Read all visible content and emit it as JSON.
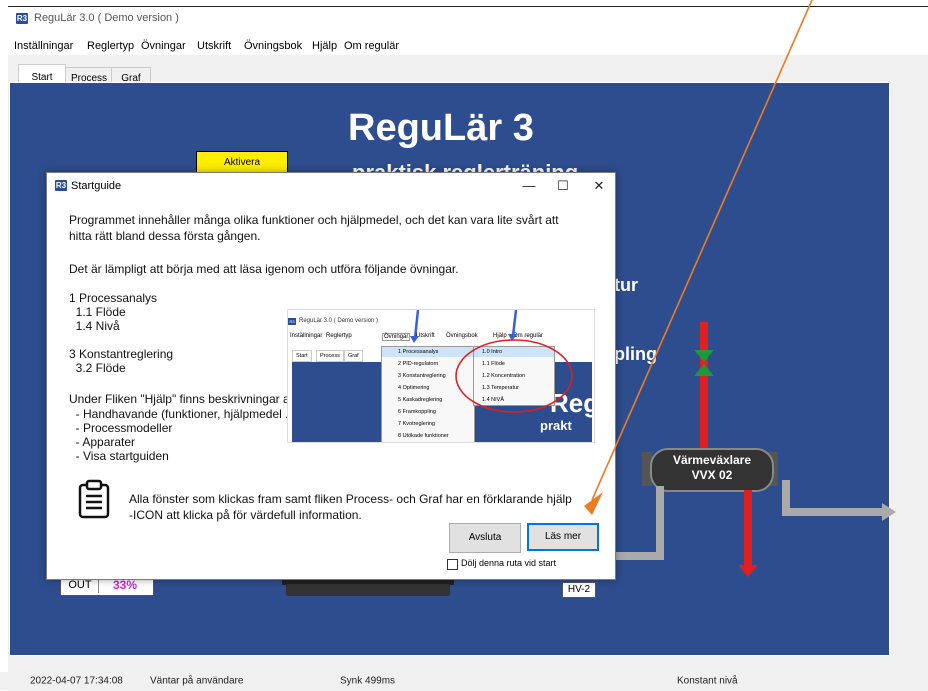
{
  "window": {
    "title": "ReguLär 3.0  ( Demo version )",
    "app_icon": "R3"
  },
  "menu": [
    "Inställningar",
    "Reglertyp",
    "Övningar",
    "Utskrift",
    "Övningsbok",
    "Hjälp",
    "Om regulär"
  ],
  "tabs": [
    "Start",
    "Process",
    "Graf"
  ],
  "background": {
    "title": "ReguLär 3",
    "subtitle": "praktisk reglerträning",
    "aktivera_label": "Aktivera",
    "label_tur": "tur",
    "label_pling": "pling",
    "heat_exchanger": [
      "Värmeväxlare",
      "VVX 02"
    ],
    "valve_label": "HV-2",
    "out_label": "OUT",
    "out_value": "33%",
    "colors": {
      "panel": "#2e4d8e",
      "hot_pipe": "#e02020",
      "valve": "#1a9a3a",
      "out_value": "#e020e0"
    }
  },
  "status_bar": {
    "timestamp": "2022-04-07 17:34:08",
    "state": "Väntar på användare",
    "sync": "Synk 499ms",
    "mode": "Konstant nivå"
  },
  "dialog": {
    "title": "Startguide",
    "window_buttons": {
      "minimize": "—",
      "maximize": "☐",
      "close": "✕"
    },
    "intro_lines": [
      "Programmet innehåller många olika funktioner och hjälpmedel, och det kan vara lite svårt att",
      "hitta rätt bland dessa första gången."
    ],
    "recommend": "Det är lämpligt att börja med att läsa igenom och utföra följande övningar.",
    "exercises": [
      "1 Processanalys",
      "  1.1 Flöde",
      "  1.4 Nivå",
      "",
      "3 Konstantreglering",
      "  3.2 Flöde"
    ],
    "help_intro": "Under Fliken \"Hjälp\" finns beskrivningar av",
    "help_items": [
      "  - Handhavande (funktioner, hjälpmedel ..)",
      "  - Processmodeller",
      "  - Apparater",
      "  - Visa startguiden"
    ],
    "footer_lines": [
      "Alla fönster som klickas fram samt fliken Process- och Graf har en förklarande hjälp",
      "-ICON att klicka på för värdefull information."
    ],
    "btn_quit": "Avsluta",
    "btn_read_more": "Läs mer",
    "checkbox_label": "Dölj denna ruta vid start",
    "checkbox_checked": false
  },
  "mini_screenshot": {
    "title": "ReguLär 3.0  ( Demo version )",
    "menu": [
      "Inställningar",
      "Reglertyp",
      "Övningar",
      "Utskrift",
      "Övningsbok",
      "Hjälp",
      "Om regulär"
    ],
    "tabs": [
      "Start",
      "Process",
      "Graf"
    ],
    "exercise_menu": [
      "1 Processanalys",
      "2 PID-regulatorn",
      "3 Konstantreglering",
      "4 Optimering",
      "5 Kaskadreglering",
      "6 Framkoppling",
      "7 Kvotreglering",
      "8 Utökade funktioner"
    ],
    "submenu": [
      "1.0 Intro",
      "1.1 Flöde",
      "1.2 Koncentration",
      "1.3 Temperatur",
      "1.4 NIVÅ"
    ],
    "bg_big": "Reg",
    "bg_small": "prakt"
  }
}
